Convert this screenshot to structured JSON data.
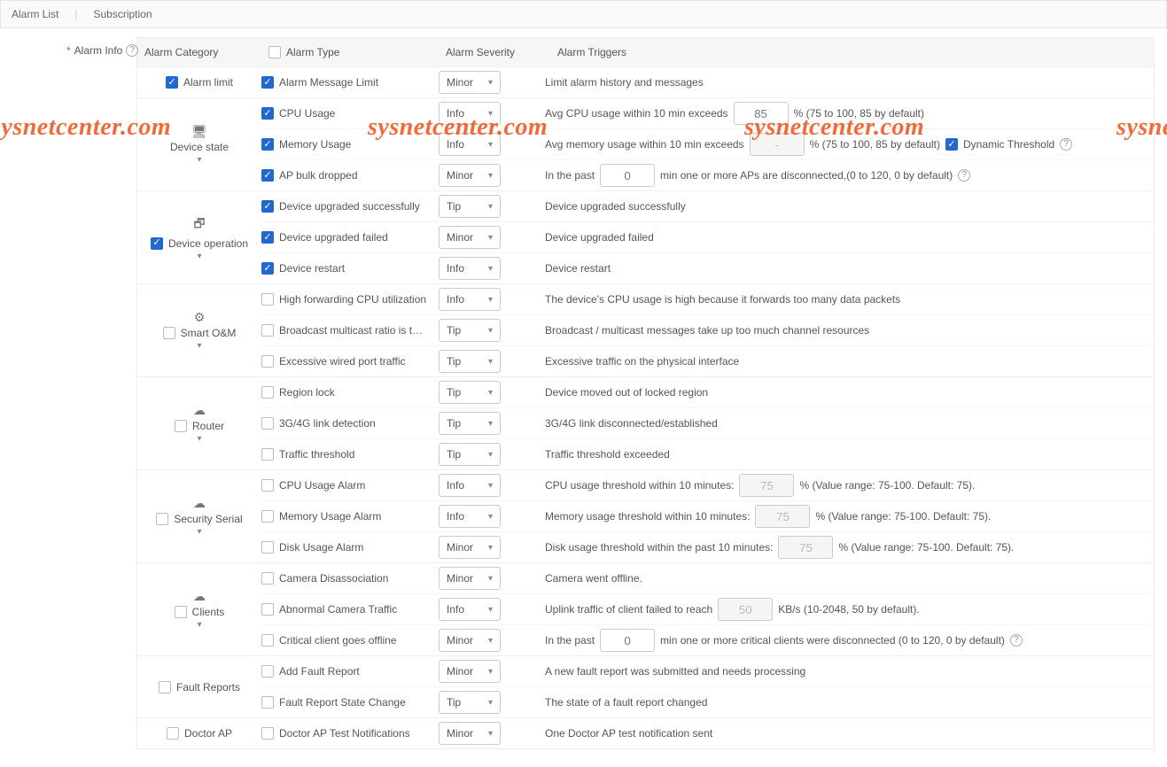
{
  "tabs": {
    "alarm_list": "Alarm List",
    "subscription": "Subscription"
  },
  "side": {
    "req": "*",
    "label": "Alarm Info"
  },
  "headers": {
    "category": "Alarm Category",
    "type": "Alarm Type",
    "severity": "Alarm Severity",
    "triggers": "Alarm Triggers"
  },
  "severity": {
    "minor": "Minor",
    "info": "Info",
    "tip": "Tip"
  },
  "cats": {
    "alarm_limit": "Alarm limit",
    "device_state": "Device state",
    "device_operation": "Device operation",
    "smart_om": "Smart O&M",
    "router": "Router",
    "security_serial": "Security Serial",
    "clients": "Clients",
    "fault_reports": "Fault Reports",
    "doctor_ap": "Doctor AP"
  },
  "rows": {
    "alarm_msg_limit": {
      "type": "Alarm Message Limit",
      "trig": "Limit alarm history and messages"
    },
    "cpu_usage": {
      "type": "CPU Usage",
      "t1": "Avg CPU usage within 10 min exceeds",
      "val": "85",
      "t2": "% (75 to 100, 85 by default)"
    },
    "mem_usage": {
      "type": "Memory Usage",
      "t1": "Avg memory usage within 10 min exceeds",
      "val": "-",
      "t2": "% (75 to 100, 85 by default)",
      "dyn": "Dynamic Threshold"
    },
    "ap_bulk": {
      "type": "AP bulk dropped",
      "t1": "In the past",
      "val": "0",
      "t2": "min one or more APs are disconnected,(0 to 120, 0 by default)"
    },
    "dev_up_ok": {
      "type": "Device upgraded successfully",
      "trig": "Device upgraded successfully"
    },
    "dev_up_fail": {
      "type": "Device upgraded failed",
      "trig": "Device upgraded failed"
    },
    "dev_restart": {
      "type": "Device restart",
      "trig": "Device restart"
    },
    "high_fwd": {
      "type": "High forwarding CPU utilization",
      "trig": "The device's CPU usage is high because it forwards too many data packets"
    },
    "bcast": {
      "type": "Broadcast multicast ratio is t…",
      "trig": "Broadcast / multicast messages take up too much channel resources"
    },
    "exc_wired": {
      "type": "Excessive wired port traffic",
      "trig": "Excessive traffic on the physical interface"
    },
    "region_lock": {
      "type": "Region lock",
      "trig": "Device moved out of locked region"
    },
    "link_3g4g": {
      "type": "3G/4G link detection",
      "trig": "3G/4G link disconnected/established"
    },
    "traf_thres": {
      "type": "Traffic threshold",
      "trig": "Traffic threshold exceeded"
    },
    "ss_cpu": {
      "type": "CPU Usage Alarm",
      "t1": "CPU usage threshold within 10 minutes:",
      "val": "75",
      "t2": "% (Value range: 75-100. Default: 75)."
    },
    "ss_mem": {
      "type": "Memory Usage Alarm",
      "t1": "Memory usage threshold within 10 minutes:",
      "val": "75",
      "t2": "% (Value range: 75-100. Default: 75)."
    },
    "ss_disk": {
      "type": "Disk Usage Alarm",
      "t1": "Disk usage threshold within the past 10 minutes:",
      "val": "75",
      "t2": "% (Value range: 75-100. Default: 75)."
    },
    "cam_dis": {
      "type": "Camera Disassociation",
      "trig": "Camera went offline."
    },
    "cam_traf": {
      "type": "Abnormal Camera Traffic",
      "t1": "Uplink traffic of client failed to reach",
      "val": "50",
      "t2": "KB/s (10-2048, 50 by default)."
    },
    "crit_cli": {
      "type": "Critical client goes offline",
      "t1": "In the past",
      "val": "0",
      "t2": "min one or more critical clients were disconnected (0 to 120, 0 by default)"
    },
    "add_fault": {
      "type": "Add Fault Report",
      "trig": "A new fault report was submitted and needs processing"
    },
    "fault_state": {
      "type": "Fault Report State Change",
      "trig": "The state of a fault report changed"
    },
    "doctor_notif": {
      "type": "Doctor AP Test Notifications",
      "trig": "One Doctor AP test notification sent"
    }
  },
  "watermark": "sysnetcenter.com"
}
